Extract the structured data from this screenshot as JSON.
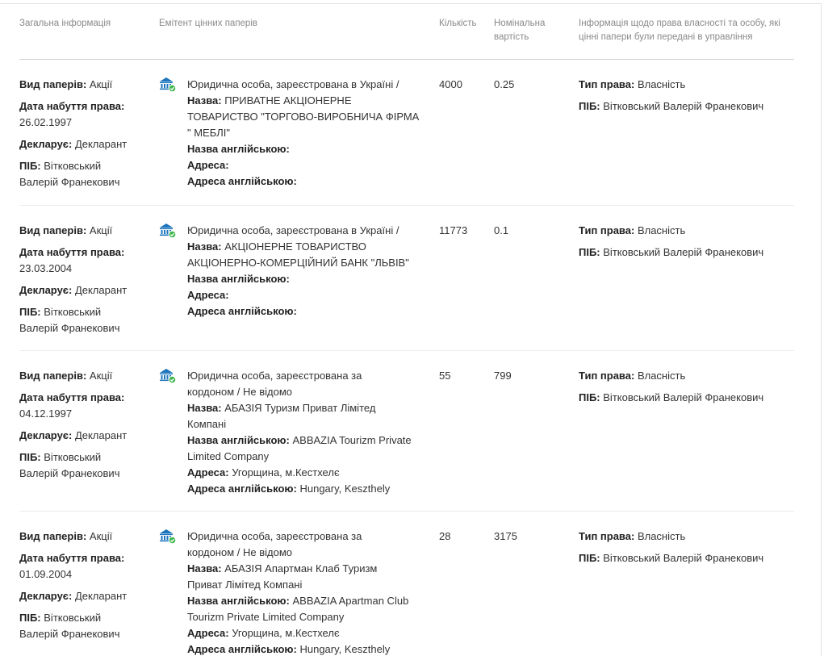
{
  "header": {
    "general": "Загальна інформація",
    "issuer": "Емітент цінних паперів",
    "qty": "Кількість",
    "nominal_line1": "Номінальна",
    "nominal_line2": "вартість",
    "owner_line1": "Інформація щодо права власності та особу, які",
    "owner_line2": "цінні папери були передані в управління"
  },
  "labels": {
    "type": "Вид паперів:",
    "date": "Дата набуття права:",
    "declares": "Декларує:",
    "pib": "ПІБ:",
    "name": "Назва:",
    "name_en": "Назва англійською:",
    "address": "Адреса:",
    "address_en": "Адреса англійською:",
    "right_type": "Тип права:"
  },
  "icons": {
    "issuer": "bank-verified-icon"
  },
  "colors": {
    "icon_blue": "#1c75bc",
    "icon_green": "#3cb54a"
  },
  "rows": [
    {
      "type": "Акції",
      "date": "26.02.1997",
      "declares": "Декларант",
      "pib_line1": "Вітковський",
      "pib_line2": "Валерій Франекович",
      "issuer_lines": [
        "Юридична особа, зареєстрована в Україні /"
      ],
      "name_lines": [
        "ПРИВАТНЕ АКЦІОНЕРНЕ",
        "ТОВАРИСТВО \"ТОРГОВО-ВИРОБНИЧА ФІРМА",
        "\" МЕБЛІ\""
      ],
      "name_en_lines": [
        ""
      ],
      "address_lines": [
        ""
      ],
      "address_en_lines": [
        ""
      ],
      "qty": "4000",
      "nominal": "0.25",
      "right_type": "Власність",
      "owner_pib": "Вітковський Валерій Франекович"
    },
    {
      "type": "Акції",
      "date": "23.03.2004",
      "declares": "Декларант",
      "pib_line1": "Вітковський",
      "pib_line2": "Валерій Франекович",
      "issuer_lines": [
        "Юридична особа, зареєстрована в Україні /"
      ],
      "name_lines": [
        "АКЦІОНЕРНЕ ТОВАРИСТВО",
        "АКЦІОНЕРНО-КОМЕРЦІЙНИЙ БАНК \"ЛЬВІВ\""
      ],
      "name_en_lines": [
        ""
      ],
      "address_lines": [
        ""
      ],
      "address_en_lines": [
        ""
      ],
      "qty": "11773",
      "nominal": "0.1",
      "right_type": "Власність",
      "owner_pib": "Вітковський Валерій Франекович"
    },
    {
      "type": "Акції",
      "date": "04.12.1997",
      "declares": "Декларант",
      "pib_line1": "Вітковський",
      "pib_line2": "Валерій Франекович",
      "issuer_lines": [
        "Юридична особа, зареєстрована за",
        "кордоном / Не відомо"
      ],
      "name_lines": [
        "АБАЗІЯ Туризм Приват Лімітед",
        "Компані"
      ],
      "name_en_lines": [
        "ABBAZIA Tourizm Private",
        "Limited Company"
      ],
      "address_lines": [
        "Угорщина, м.Кестхелє"
      ],
      "address_en_lines": [
        "Hungary, Keszthely"
      ],
      "qty": "55",
      "nominal": "799",
      "right_type": "Власність",
      "owner_pib": "Вітковський Валерій Франекович"
    },
    {
      "type": "Акції",
      "date": "01.09.2004",
      "declares": "Декларант",
      "pib_line1": "Вітковський",
      "pib_line2": "Валерій Франекович",
      "issuer_lines": [
        "Юридична особа, зареєстрована за",
        "кордоном / Не відомо"
      ],
      "name_lines": [
        "АБАЗІЯ Апартман Клаб Туризм",
        "Приват Лімітед Компані"
      ],
      "name_en_lines": [
        "ABBAZIA Apartman Club",
        "Tourizm Private Limited Company"
      ],
      "address_lines": [
        "Угорщина, м.Кестхелє"
      ],
      "address_en_lines": [
        "Hungary, Keszthely"
      ],
      "qty": "28",
      "nominal": "3175",
      "right_type": "Власність",
      "owner_pib": "Вітковський Валерій Франекович"
    }
  ]
}
